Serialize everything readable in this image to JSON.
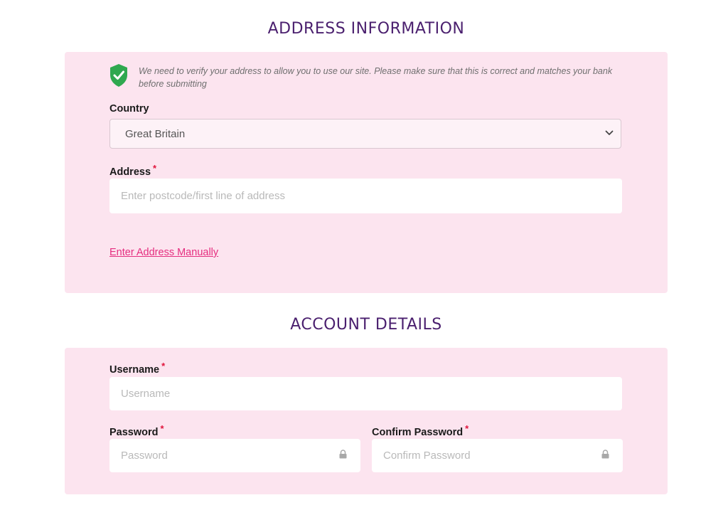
{
  "address_section": {
    "title": "ADDRESS INFORMATION",
    "notice": "We need to verify your address to allow you to use our site. Please make sure that this is correct and matches your bank before submitting",
    "country_label": "Country",
    "country_value": "Great Britain",
    "address_label": "Address",
    "address_placeholder": "Enter postcode/first line of address",
    "manual_link": "Enter Address Manually"
  },
  "account_section": {
    "title": "ACCOUNT DETAILS",
    "username_label": "Username",
    "username_placeholder": "Username",
    "password_label": "Password",
    "password_placeholder": "Password",
    "confirm_label": "Confirm Password",
    "confirm_placeholder": "Confirm Password"
  },
  "required_mark": "*",
  "icons": {
    "shield": "shield-check-icon",
    "select_arrow": "chevron-down-icon",
    "lock": "lock-icon"
  },
  "colors": {
    "title": "#4a1f6e",
    "panel_bg": "#fce4ef",
    "shield": "#2fa84f",
    "link": "#e52d7f",
    "required": "#e0143c"
  }
}
